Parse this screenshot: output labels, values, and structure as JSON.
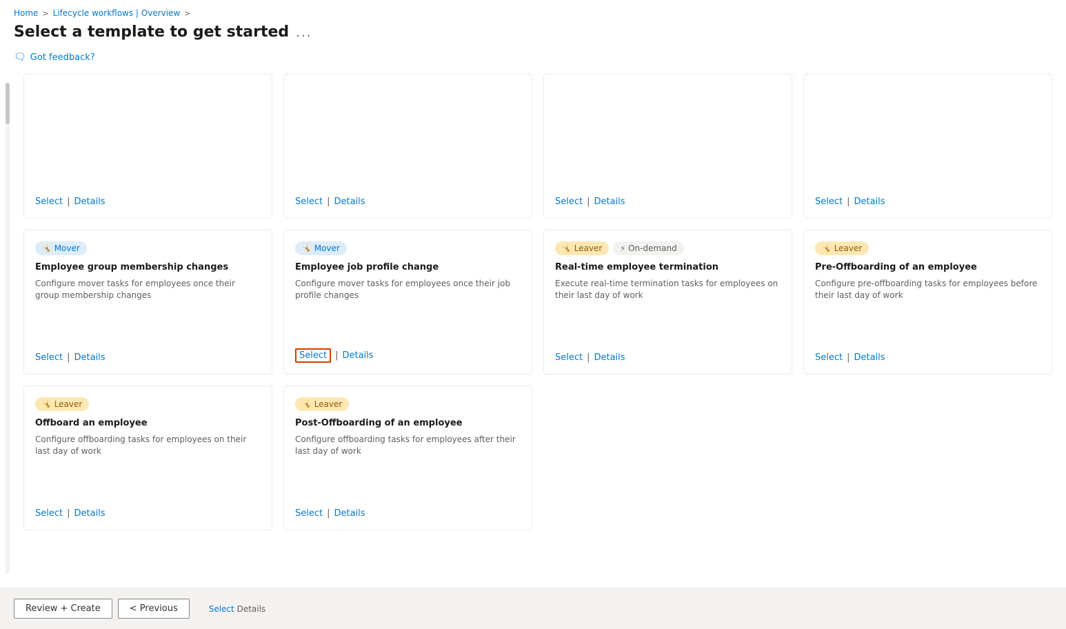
{
  "breadcrumb": {
    "home": "Home",
    "separator1": ">",
    "lifecycle": "Lifecycle workflows | Overview",
    "separator2": ">"
  },
  "page_title": "Select a template to get started",
  "more_options": "...",
  "feedback": "Got feedback?",
  "step_label": "Select Details",
  "bottom_bar": {
    "review_create": "Review + Create",
    "previous": "< Previous"
  },
  "cards": [
    {
      "id": "card-1",
      "tags": [],
      "title": "",
      "desc": "",
      "select_label": "Select",
      "details_label": "Details"
    },
    {
      "id": "card-2",
      "tags": [],
      "title": "",
      "desc": "",
      "select_label": "Select",
      "details_label": "Details"
    },
    {
      "id": "card-3",
      "tags": [],
      "title": "",
      "desc": "",
      "select_label": "Select",
      "details_label": "Details"
    },
    {
      "id": "card-4",
      "tags": [],
      "title": "",
      "desc": "",
      "select_label": "Select",
      "details_label": "Details"
    },
    {
      "id": "card-5",
      "tags": [
        {
          "label": "Mover",
          "type": "mover"
        }
      ],
      "title": "Employee group membership changes",
      "desc": "Configure mover tasks for employees once their group membership changes",
      "select_label": "Select",
      "details_label": "Details"
    },
    {
      "id": "card-6",
      "tags": [
        {
          "label": "Mover",
          "type": "mover"
        }
      ],
      "title": "Employee job profile change",
      "desc": "Configure mover tasks for employees once their job profile changes",
      "select_label": "Select",
      "details_label": "Details",
      "select_highlighted": true
    },
    {
      "id": "card-7",
      "tags": [
        {
          "label": "Leaver",
          "type": "leaver"
        },
        {
          "label": "On-demand",
          "type": "ondemand"
        }
      ],
      "title": "Real-time employee termination",
      "desc": "Execute real-time termination tasks for employees on their last day of work",
      "select_label": "Select",
      "details_label": "Details"
    },
    {
      "id": "card-8",
      "tags": [
        {
          "label": "Leaver",
          "type": "leaver"
        }
      ],
      "title": "Pre-Offboarding of an employee",
      "desc": "Configure pre-offboarding tasks for employees before their last day of work",
      "select_label": "Select",
      "details_label": "Details"
    },
    {
      "id": "card-9",
      "tags": [
        {
          "label": "Leaver",
          "type": "leaver"
        }
      ],
      "title": "Offboard an employee",
      "desc": "Configure offboarding tasks for employees on their last day of work",
      "select_label": "Select",
      "details_label": "Details"
    },
    {
      "id": "card-10",
      "tags": [
        {
          "label": "Leaver",
          "type": "leaver"
        }
      ],
      "title": "Post-Offboarding of an employee",
      "desc": "Configure offboarding tasks for employees after their last day of work",
      "select_label": "Select",
      "details_label": "Details"
    }
  ]
}
